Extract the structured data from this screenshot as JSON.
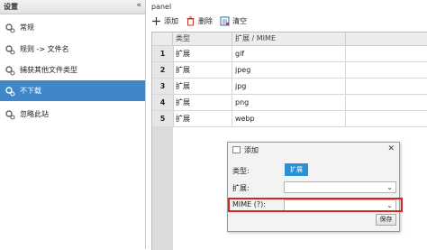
{
  "sidebar": {
    "title": "设置",
    "collapse_glyph": "«",
    "items": [
      {
        "label": "常规",
        "selected": false
      },
      {
        "label": "规则 -> 文件名",
        "selected": false
      },
      {
        "label": "捕获其他文件类型",
        "selected": false
      },
      {
        "label": "不下载",
        "selected": true
      },
      {
        "label": "忽略此站",
        "selected": false
      }
    ]
  },
  "panel": {
    "title": "panel",
    "toolbar": {
      "add_label": "添加",
      "delete_label": "删除",
      "clear_label": "清空"
    },
    "table": {
      "columns": [
        "类型",
        "扩展 / MIME"
      ],
      "rows": [
        {
          "num": "1",
          "type": "扩展",
          "value": "gif"
        },
        {
          "num": "2",
          "type": "扩展",
          "value": "jpeg"
        },
        {
          "num": "3",
          "type": "扩展",
          "value": "jpg"
        },
        {
          "num": "4",
          "type": "扩展",
          "value": "png"
        },
        {
          "num": "5",
          "type": "扩展",
          "value": "webp"
        }
      ]
    }
  },
  "dialog": {
    "title": "添加",
    "close_glyph": "✕",
    "type_label": "类型:",
    "type_value": "扩展",
    "ext_label": "扩展:",
    "ext_value": "",
    "mime_label": "MIME (?):",
    "mime_value": "",
    "save_label": "保存"
  },
  "colors": {
    "selected_bg": "#3f87c8",
    "badge_bg": "#2b8fd4",
    "highlight_border": "#d42626"
  }
}
